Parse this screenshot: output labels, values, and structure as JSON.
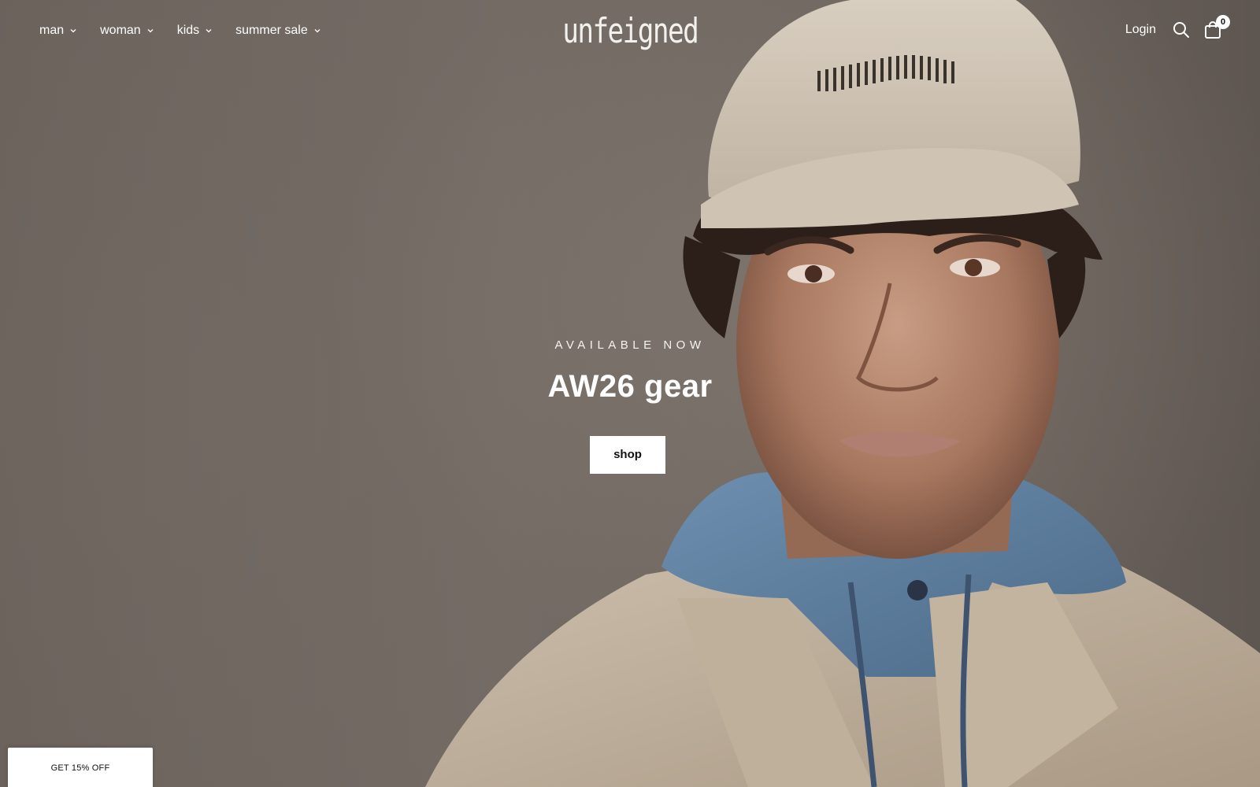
{
  "brand": {
    "logo_text": "unfeigned"
  },
  "nav": {
    "items": [
      {
        "label": "man"
      },
      {
        "label": "woman"
      },
      {
        "label": "kids"
      },
      {
        "label": "summer sale"
      }
    ]
  },
  "utility": {
    "login_label": "Login",
    "search_icon": "search-icon",
    "cart_icon": "shopping-bag-icon",
    "cart_count": "0"
  },
  "hero": {
    "eyebrow": "AVAILABLE NOW",
    "headline": "AW26 gear",
    "cta_label": "shop"
  },
  "discount_tab": {
    "label": "GET 15% OFF"
  },
  "colors": {
    "background": "#6d655f",
    "text": "#ffffff",
    "button_bg": "#ffffff",
    "button_text": "#111111"
  }
}
